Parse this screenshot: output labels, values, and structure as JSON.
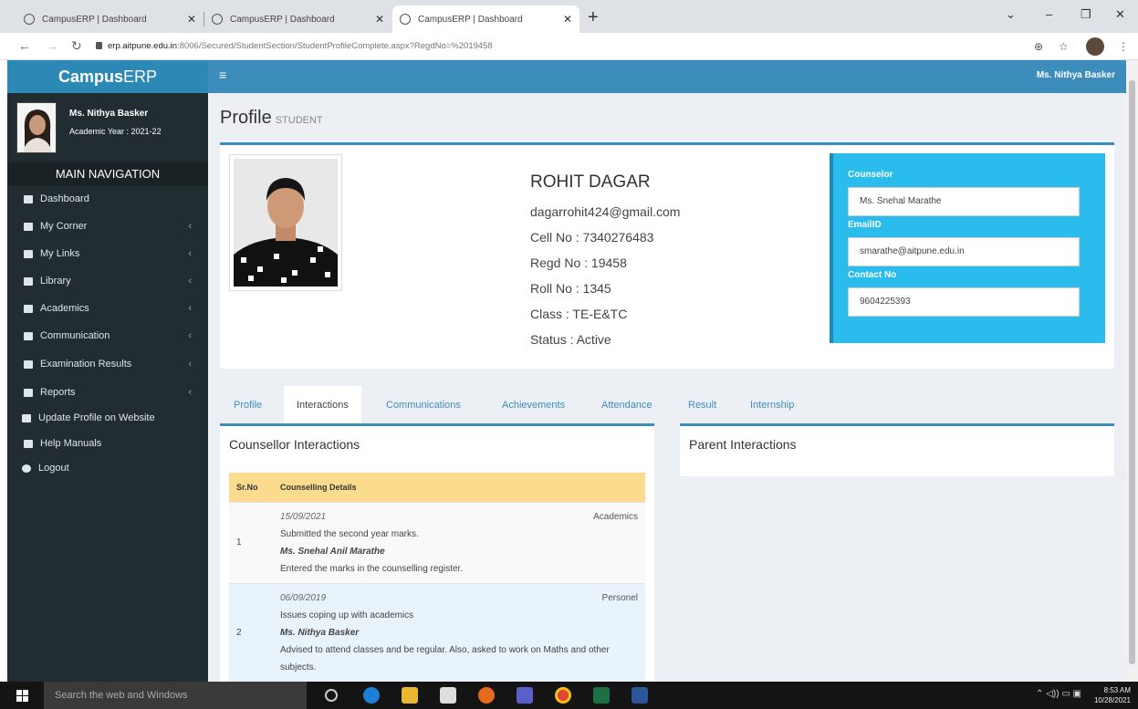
{
  "browser": {
    "tabs": [
      {
        "title": "CampusERP | Dashboard",
        "active": false
      },
      {
        "title": "CampusERP | Dashboard",
        "active": false
      },
      {
        "title": "CampusERP | Dashboard",
        "active": true
      }
    ],
    "new_tab": "+",
    "url_host": "erp.aitpune.edu.in",
    "url_rest": ":8006/Secured/StudentSection/StudentProfileComplete.aspx?RegdNo=%2019458",
    "window_controls": {
      "dropdown": "⌄",
      "minimize": "–",
      "restore": "❐",
      "close": "✕"
    }
  },
  "app": {
    "brand_prefix": "Campus",
    "brand_suffix": "ERP",
    "top_user": "Ms. Nithya Basker"
  },
  "sidebar": {
    "user_name": "Ms. Nithya Basker",
    "academic_year": "Academic Year : 2021-22",
    "nav_header": "MAIN NAVIGATION",
    "items": [
      {
        "label": "Dashboard",
        "icon": "bank-icon",
        "has_children": false
      },
      {
        "label": "My Corner",
        "icon": "user-icon",
        "has_children": true
      },
      {
        "label": "My Links",
        "icon": "user-icon",
        "has_children": true
      },
      {
        "label": "Library",
        "icon": "book-icon",
        "has_children": true
      },
      {
        "label": "Academics",
        "icon": "folder-icon",
        "has_children": true
      },
      {
        "label": "Communication",
        "icon": "folder-icon",
        "has_children": true
      },
      {
        "label": "Examination Results",
        "icon": "folder-icon",
        "has_children": true
      },
      {
        "label": "Reports",
        "icon": "folder-icon",
        "has_children": true
      },
      {
        "label": "Update Profile on Website",
        "icon": "edit-icon",
        "has_children": false
      },
      {
        "label": "Help Manuals",
        "icon": "book-icon",
        "has_children": false
      },
      {
        "label": "Logout",
        "icon": "power-icon",
        "has_children": false
      }
    ]
  },
  "page": {
    "title": "Profile",
    "subtitle": "STUDENT"
  },
  "student": {
    "name": "ROHIT DAGAR",
    "email": "dagarrohit424@gmail.com",
    "cell": "Cell No : 7340276483",
    "regd": "Regd No : 19458",
    "roll": "Roll No : 1345",
    "class": "Class : TE-E&TC",
    "status": "Status : Active"
  },
  "counselor": {
    "counselor_label": "Counselor",
    "counselor_value": "Ms. Snehal Marathe",
    "email_label": "EmailID",
    "email_value": "smarathe@aitpune.edu.in",
    "contact_label": "Contact No",
    "contact_value": "9604225393"
  },
  "profile_tabs": [
    {
      "label": "Profile",
      "active": false
    },
    {
      "label": "Interactions",
      "active": true
    },
    {
      "label": "Communications",
      "active": false
    },
    {
      "label": "Achievements",
      "active": false
    },
    {
      "label": "Attendance",
      "active": false
    },
    {
      "label": "Result",
      "active": false
    },
    {
      "label": "Internship",
      "active": false
    }
  ],
  "counsellor_interactions": {
    "title": "Counsellor Interactions",
    "columns": [
      "Sr.No",
      "Counselling Details"
    ],
    "rows": [
      {
        "sr": "1",
        "date": "15/09/2021",
        "category": "Academics",
        "issue": "Submitted the second year marks.",
        "by": "Ms. Snehal Anil Marathe",
        "action": "Entered the marks in the counselling register."
      },
      {
        "sr": "2",
        "date": "06/09/2019",
        "category": "Personel",
        "issue": "Issues coping up with academics",
        "by": "Ms. Nithya Basker",
        "action": "Advised to attend classes and be regular. Also, asked to work on Maths and other subjects."
      }
    ]
  },
  "parent_interactions": {
    "title": "Parent Interactions"
  },
  "taskbar": {
    "search_placeholder": "Search the web and Windows",
    "time": "8:53 AM",
    "date": "10/28/2021"
  },
  "colors": {
    "header_blue": "#3c8dbc",
    "sidebar_dark": "#222d32",
    "counselor_box": "#2abced",
    "table_header": "#fbdc8f"
  }
}
